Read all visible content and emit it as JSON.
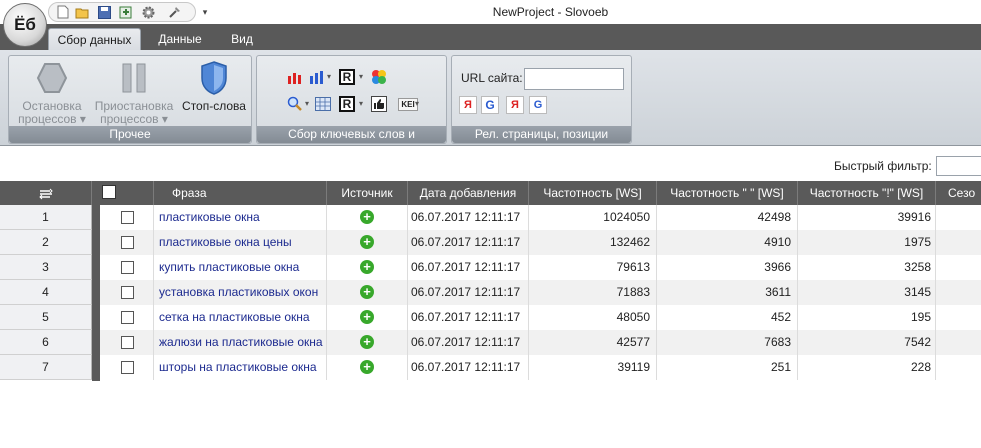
{
  "app": {
    "logo_text": "Ёб",
    "title": "NewProject - Slovoeb"
  },
  "quick_access": [
    "new-file-icon",
    "open-folder-icon",
    "save-icon",
    "export-icon",
    "settings-gear-icon",
    "pin-icon"
  ],
  "tabs": [
    {
      "label": "Сбор данных",
      "active": true
    },
    {
      "label": "Данные",
      "active": false
    },
    {
      "label": "Вид",
      "active": false
    }
  ],
  "ribbon": {
    "group_other": {
      "caption": "Прочее",
      "stop_processes": "Остановка процессов",
      "pause_processes": "Приостановка процессов",
      "stop_words": "Стоп-слова"
    },
    "group_keywords": {
      "caption": "Сбор ключевых слов и статистики",
      "r_label": "R",
      "kei_label": "KEI"
    },
    "group_rel": {
      "caption": "Рел. страницы, позиции",
      "url_label": "URL сайта:",
      "url_value": "",
      "google_label": "G"
    }
  },
  "filter": {
    "label": "Быстрый фильтр:",
    "value": ""
  },
  "grid": {
    "columns": [
      "Фраза",
      "Источник",
      "Дата добавления",
      "Частотность [WS]",
      "Частотность \" \" [WS]",
      "Частотность \"!\" [WS]",
      "Сезо"
    ],
    "rows": [
      {
        "num": "1",
        "phrase": "пластиковые окна",
        "date": "06.07.2017 12:11:17",
        "f1": "1024050",
        "f2": "42498",
        "f3": "39916"
      },
      {
        "num": "2",
        "phrase": "пластиковые окна цены",
        "date": "06.07.2017 12:11:17",
        "f1": "132462",
        "f2": "4910",
        "f3": "1975"
      },
      {
        "num": "3",
        "phrase": "купить пластиковые окна",
        "date": "06.07.2017 12:11:17",
        "f1": "79613",
        "f2": "3966",
        "f3": "3258"
      },
      {
        "num": "4",
        "phrase": "установка пластиковых окон",
        "date": "06.07.2017 12:11:17",
        "f1": "71883",
        "f2": "3611",
        "f3": "3145"
      },
      {
        "num": "5",
        "phrase": "сетка на пластиковые окна",
        "date": "06.07.2017 12:11:17",
        "f1": "48050",
        "f2": "452",
        "f3": "195"
      },
      {
        "num": "6",
        "phrase": "жалюзи на пластиковые окна",
        "date": "06.07.2017 12:11:17",
        "f1": "42577",
        "f2": "7683",
        "f3": "7542"
      },
      {
        "num": "7",
        "phrase": "шторы на пластиковые окна",
        "date": "06.07.2017 12:11:17",
        "f1": "39119",
        "f2": "251",
        "f3": "228"
      }
    ]
  },
  "colors": {
    "tabstrip": "#595959",
    "grid_header": "#5a5a5a",
    "phrase_link": "#1c2a8f",
    "source_plus": "#38a82b"
  }
}
